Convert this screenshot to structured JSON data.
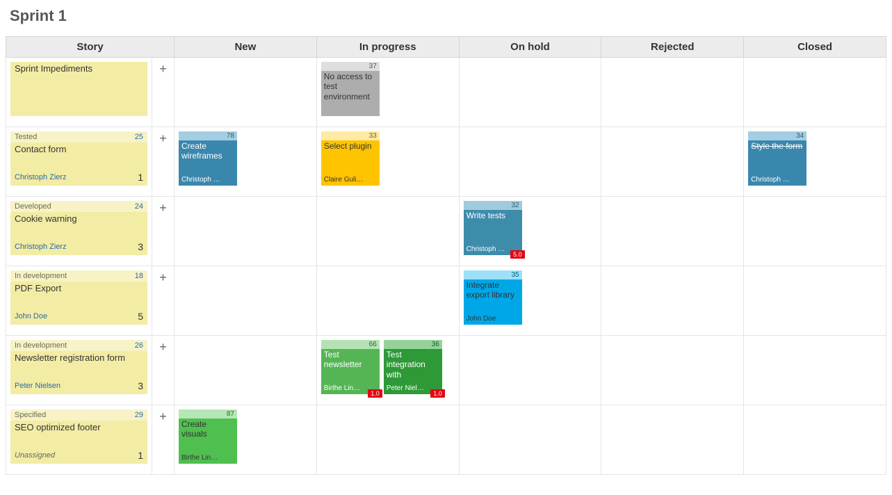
{
  "title": "Sprint 1",
  "columns": [
    "Story",
    "New",
    "In progress",
    "On hold",
    "Rejected",
    "Closed"
  ],
  "add_label": "+",
  "rows": [
    {
      "story": {
        "status": "",
        "id": "",
        "title": "Sprint Impediments",
        "assignee": "",
        "points": ""
      },
      "cells": {
        "In progress": [
          {
            "id": "37",
            "title": "No access to test environment",
            "assignee": "",
            "color": "c-grey"
          }
        ]
      }
    },
    {
      "story": {
        "status": "Tested",
        "id": "25",
        "title": "Contact form",
        "assignee": "Christoph Zierz",
        "points": "1"
      },
      "cells": {
        "New": [
          {
            "id": "78",
            "title": "Create wireframes",
            "assignee": "Christoph …",
            "color": "c-teal"
          }
        ],
        "In progress": [
          {
            "id": "33",
            "title": "Select plugin",
            "assignee": "Claire Guli…",
            "color": "c-yellow"
          }
        ],
        "Closed": [
          {
            "id": "34",
            "title": "Style the form",
            "assignee": "Christoph …",
            "color": "c-teal",
            "strike": true
          }
        ]
      }
    },
    {
      "story": {
        "status": "Developed",
        "id": "24",
        "title": "Cookie warning",
        "assignee": "Christoph Zierz",
        "points": "3"
      },
      "cells": {
        "On hold": [
          {
            "id": "32",
            "title": "Write tests",
            "assignee": "Christoph …",
            "color": "c-tealdark",
            "badge": "5.0"
          }
        ]
      }
    },
    {
      "story": {
        "status": "In development",
        "id": "18",
        "title": "PDF Export",
        "assignee": "John Doe",
        "points": "5"
      },
      "cells": {
        "On hold": [
          {
            "id": "35",
            "title": "Integrate export library",
            "assignee": "John Doe",
            "color": "c-blue"
          }
        ]
      }
    },
    {
      "story": {
        "status": "In development",
        "id": "26",
        "title": "Newsletter registration form",
        "assignee": "Peter Nielsen",
        "points": "3"
      },
      "cells": {
        "In progress": [
          {
            "id": "66",
            "title": "Test newsletter",
            "assignee": "Birthe Lin…",
            "color": "c-green1",
            "badge": "1.0"
          },
          {
            "id": "36",
            "title": "Test integration with",
            "assignee": "Peter Niel…",
            "color": "c-green2",
            "badge": "1.0"
          }
        ]
      }
    },
    {
      "story": {
        "status": "Specified",
        "id": "29",
        "title": "SEO optimized footer",
        "assignee": "Unassigned",
        "unassigned": true,
        "points": "1"
      },
      "cells": {
        "New": [
          {
            "id": "87",
            "title": "Create visuals",
            "assignee": "Birthe Lin…",
            "color": "c-green3"
          }
        ]
      }
    }
  ]
}
